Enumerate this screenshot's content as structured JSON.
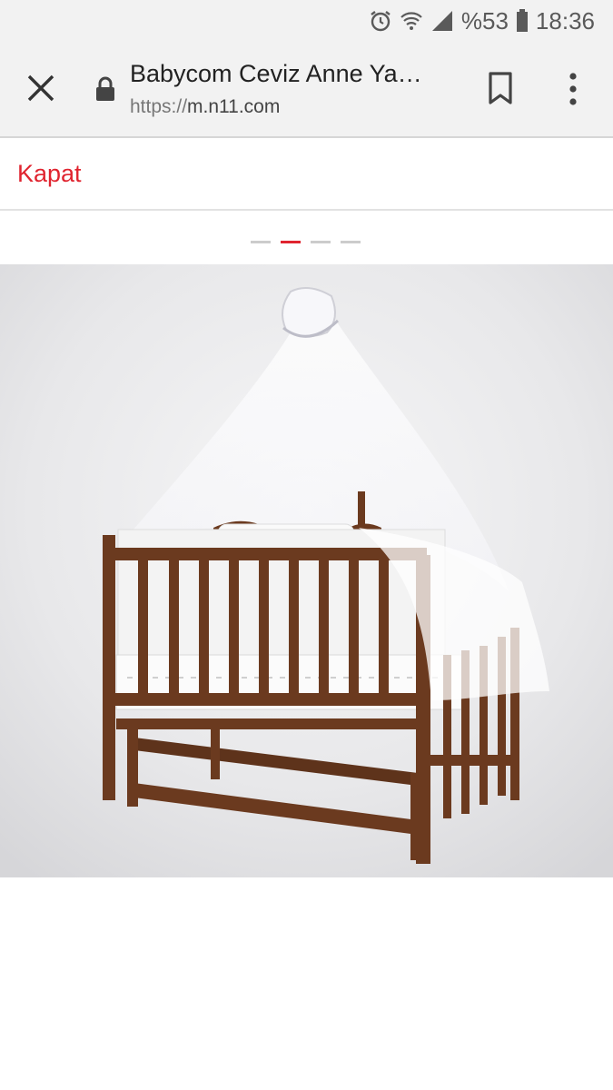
{
  "status_bar": {
    "battery": "%53",
    "time": "18:36"
  },
  "toolbar": {
    "title": "Babycom Ceviz Anne Ya…",
    "url_scheme": "https://",
    "url_host": "m.n11.com"
  },
  "gallery": {
    "close_label": "Kapat",
    "slide_count": 4,
    "active_index": 1
  },
  "colors": {
    "accent": "#e0242f",
    "wood": "#6b3a1f"
  },
  "icons": [
    "alarm-icon",
    "wifi-icon",
    "signal-icon",
    "battery-icon",
    "close-icon",
    "lock-icon",
    "bookmark-icon",
    "more-vert-icon"
  ]
}
